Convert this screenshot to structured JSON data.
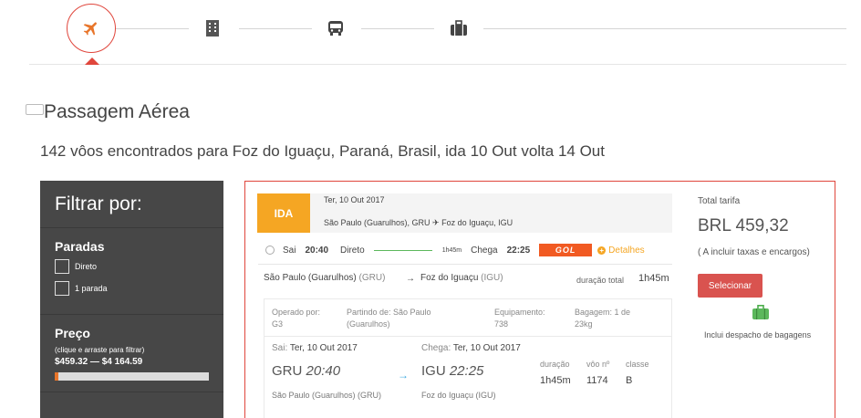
{
  "stepper": {
    "steps": [
      {
        "icon": "airplane-icon",
        "active": true
      },
      {
        "icon": "hotel-icon",
        "active": false
      },
      {
        "icon": "bus-icon",
        "active": false
      },
      {
        "icon": "suitcase-icon",
        "active": false
      }
    ],
    "accent": "#e0463c"
  },
  "section": {
    "title": "Passagem Aérea",
    "subtitle": "142 vôos encontrados para Foz do Iguaçu, Paraná, Brasil, ida 10 Out volta 14 Out"
  },
  "filter": {
    "title": "Filtrar por:",
    "stops": {
      "heading": "Paradas",
      "options": [
        "Direto",
        "1 parada"
      ]
    },
    "price": {
      "heading": "Preço",
      "hint": "(clique e arraste para filtrar)",
      "range": "$459.32 — $4 164.59"
    }
  },
  "result": {
    "badge": "IDA",
    "date": "Ter, 10 Out 2017",
    "route": "São Paulo (Guarulhos), GRU ✈ Foz do Iguaçu, IGU",
    "flight": {
      "sai_label": "Sai",
      "dep_time": "20:40",
      "type": "Direto",
      "duration_short": "1h45m",
      "chega_label": "Chega",
      "arr_time": "22:25",
      "airline_logo": "GOL",
      "details_label": "Detalhes"
    },
    "summary": {
      "origin": "São Paulo (Guarulhos)",
      "origin_code": "(GRU)",
      "dest": "Foz do Iguaçu",
      "dest_code": "(IGU)",
      "duration_label": "duração total",
      "duration": "1h45m"
    },
    "details": {
      "operated_label": "Operado por:",
      "operated": "G3",
      "departing_label": "Partindo de: São Paulo",
      "departing_2": "(Guarulhos)",
      "equipment_label": "Equipamento:",
      "equipment": "738",
      "baggage_label": "Bagagem: 1 de",
      "baggage_2": "23kg",
      "dep_date_label": "Sai:",
      "dep_date": "Ter, 10 Out 2017",
      "arr_date_label": "Chega:",
      "arr_date": "Ter, 10 Out 2017",
      "dep_code": "GRU",
      "dep_time": "20:40",
      "arr_code": "IGU",
      "arr_time": "22:25",
      "dep_city": "São Paulo (Guarulhos) (GRU)",
      "arr_city": "Foz do Iguaçu (IGU)",
      "duration_label": "duração",
      "duration": "1h45m",
      "flight_no_label": "vôo nº",
      "flight_no": "1174",
      "class_label": "classe",
      "class": "B"
    },
    "price": {
      "label": "Total tarifa",
      "value": "BRL 459,32",
      "taxes": "( A incluir taxas e encargos)",
      "select_label": "Selecionar",
      "baggage_note": "Inclui despacho de bagagens"
    }
  }
}
